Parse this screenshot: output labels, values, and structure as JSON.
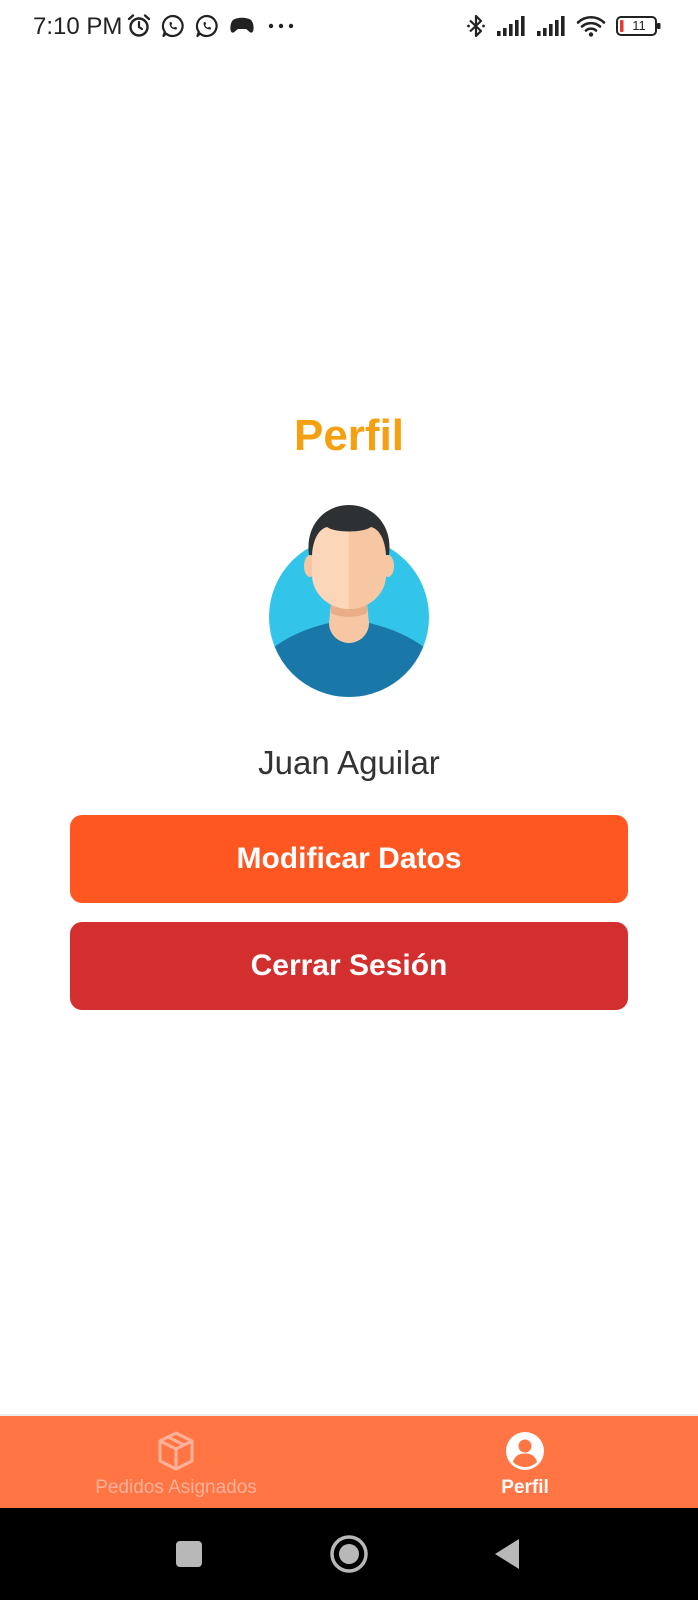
{
  "status_bar": {
    "time": "7:10 PM",
    "left_icons": [
      "alarm-icon",
      "whatsapp-icon",
      "whatsapp-icon",
      "game-controller-icon",
      "more-dots-icon"
    ],
    "right_icons": [
      "bluetooth-icon",
      "signal-icon",
      "signal-icon",
      "wifi-icon",
      "battery-icon"
    ],
    "battery_level": "11"
  },
  "profile": {
    "title": "Perfil",
    "user_name": "Juan Aguilar",
    "modify_button": "Modificar Datos",
    "logout_button": "Cerrar Sesión"
  },
  "bottom_nav": {
    "items": [
      {
        "label": "Pedidos Asignados",
        "icon": "package-box-icon",
        "active": false
      },
      {
        "label": "Perfil",
        "icon": "account-circle-icon",
        "active": true
      }
    ]
  },
  "system_nav": {
    "buttons": [
      "recents-square-icon",
      "home-circle-icon",
      "back-triangle-icon"
    ]
  },
  "colors": {
    "title": "#F4A011",
    "modify_button": "#FF5722",
    "logout_button": "#D32F2F",
    "bottom_nav_background": "#FF7543",
    "nav_inactive": "#FFB199",
    "nav_active": "#FFFFFF"
  }
}
